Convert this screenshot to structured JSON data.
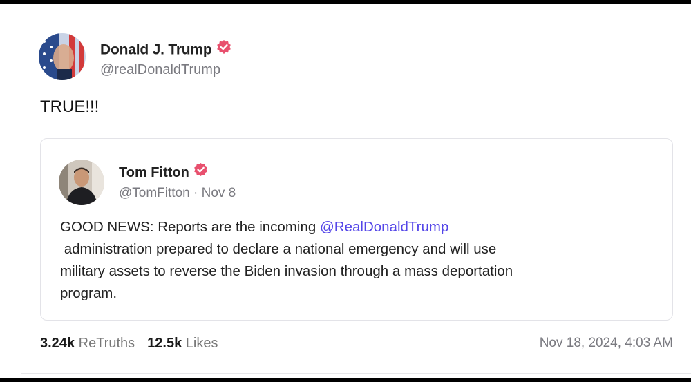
{
  "post": {
    "author": {
      "name": "Donald J. Trump",
      "handle": "@realDonaldTrump"
    },
    "text": "TRUE!!!",
    "quoted": {
      "author": {
        "name": "Tom Fitton",
        "handle": "@TomFitton",
        "separator": " · ",
        "date": "Nov 8"
      },
      "text_before": "GOOD NEWS: Reports are the incoming ",
      "mention": "@RealDonaldTrump",
      "text_line2": "administration prepared to declare a national emergency and will use",
      "text_line3": "military assets to reverse the Biden invasion through a mass deportation",
      "text_line4": "program."
    },
    "stats": {
      "retruths_count": "3.24k",
      "retruths_label": "ReTruths",
      "likes_count": "12.5k",
      "likes_label": "Likes"
    },
    "timestamp": "Nov 18, 2024, 4:03 AM"
  },
  "colors": {
    "verified_badge": "#e8506e",
    "mention": "#5446e8",
    "muted_text": "#7a7a80"
  },
  "icons": [
    "verified-badge-icon"
  ]
}
